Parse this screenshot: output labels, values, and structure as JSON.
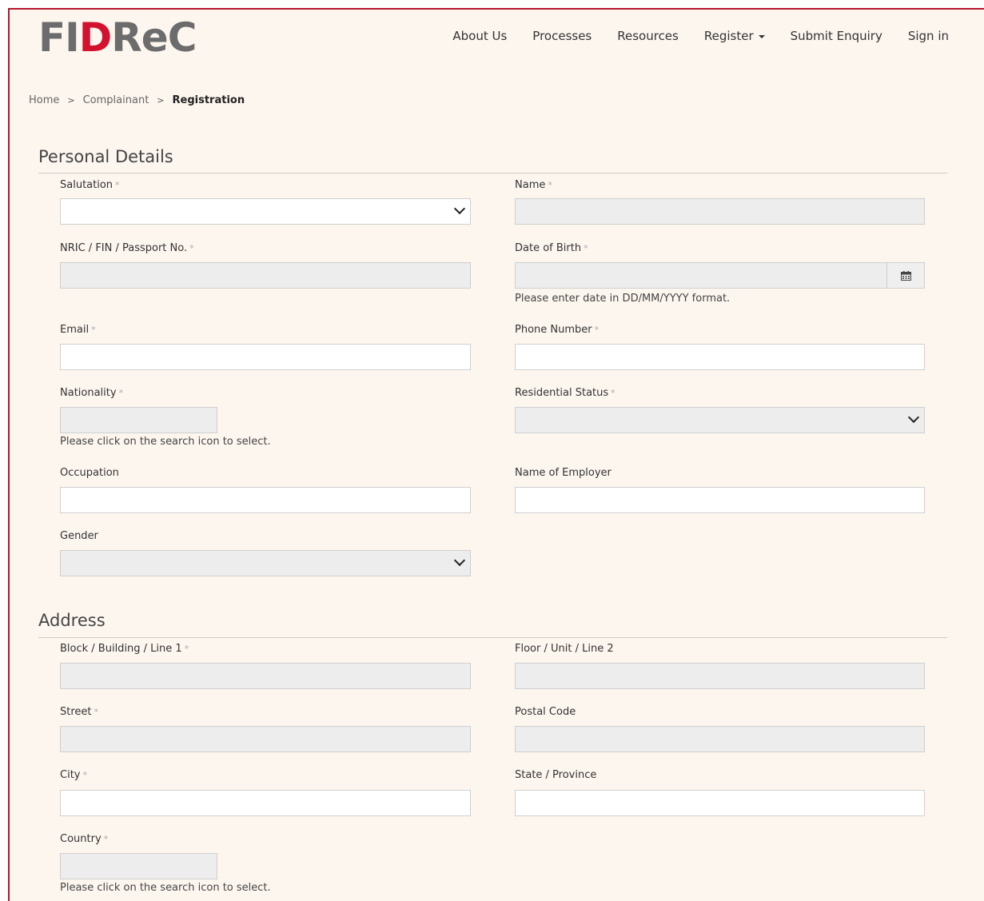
{
  "brand": {
    "logo_part1": "FI",
    "logo_part2": "D",
    "logo_part3": "ReC",
    "logo_accent_color": "#d2122e"
  },
  "nav": {
    "about": "About Us",
    "processes": "Processes",
    "resources": "Resources",
    "register": "Register",
    "enquiry": "Submit Enquiry",
    "signin": "Sign in"
  },
  "breadcrumb": {
    "home": "Home",
    "sep1": ">",
    "complainant": "Complainant",
    "sep2": ">",
    "current": "Registration"
  },
  "personal": {
    "title": "Personal Details",
    "salutation": "Salutation",
    "name": "Name",
    "nric": "NRIC / FIN / Passport No.",
    "dob": "Date of Birth",
    "dob_help": "Please enter date in DD/MM/YYYY format.",
    "email": "Email",
    "phone": "Phone Number",
    "nationality": "Nationality",
    "nationality_help": "Please click on the search icon to select.",
    "residential": "Residential Status",
    "occupation": "Occupation",
    "employer": "Name of Employer",
    "gender": "Gender"
  },
  "address": {
    "title": "Address",
    "line1": "Block / Building / Line 1",
    "line2": "Floor / Unit / Line 2",
    "street": "Street",
    "postal": "Postal Code",
    "city": "City",
    "state": "State / Province",
    "country": "Country",
    "country_help": "Please click on the search icon to select."
  },
  "required_mark": "*",
  "colors": {
    "frame_border": "#b5172d",
    "page_bg": "#fdf6ef",
    "readonly_bg": "#ededed"
  }
}
